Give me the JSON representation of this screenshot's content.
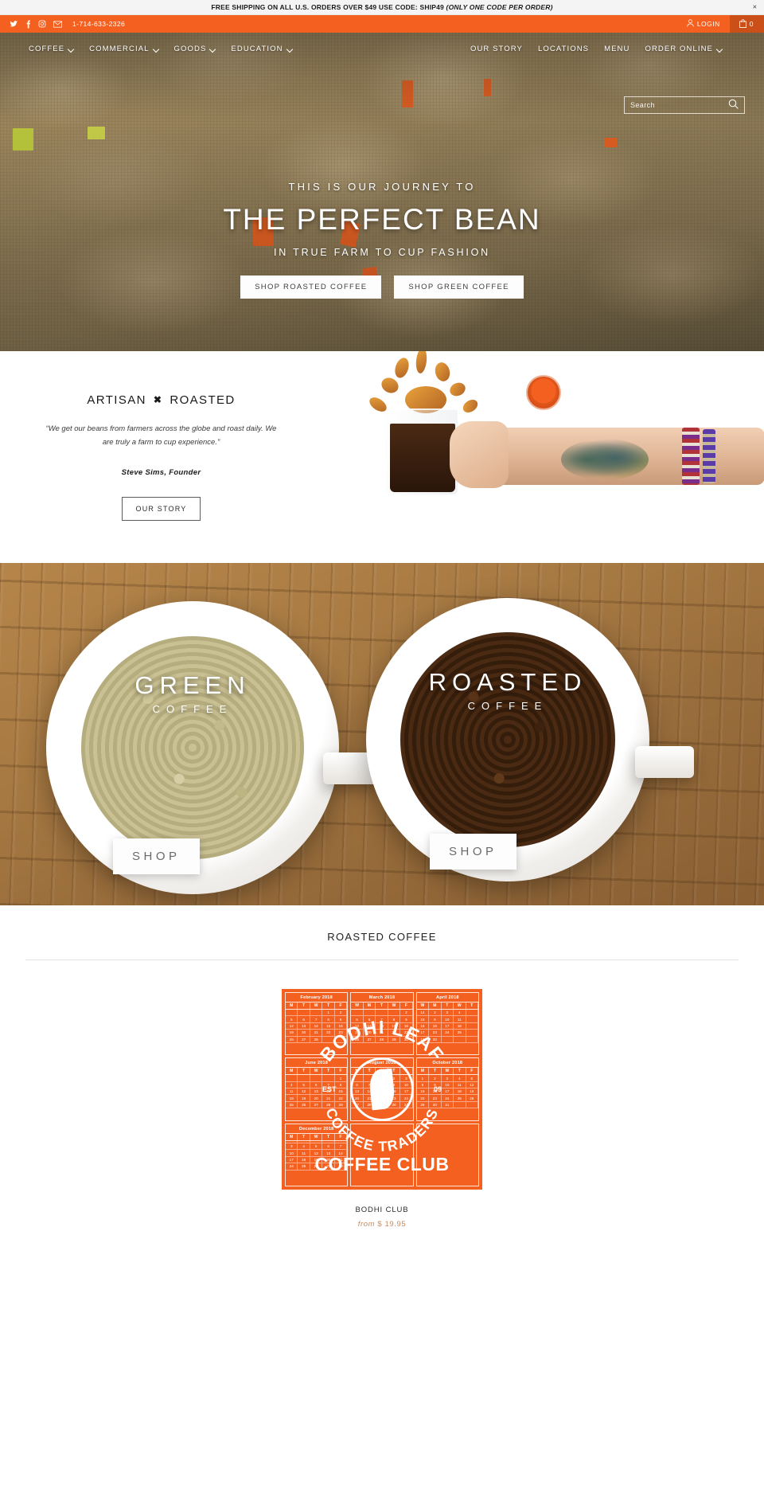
{
  "announcement": {
    "text_before": "FREE SHIPPING ON ALL U.S. ORDERS OVER $49 USE CODE: SHIP49 ",
    "text_italic": "(ONLY ONE CODE PER ORDER)",
    "close_label": "×"
  },
  "utility": {
    "phone": "1-714-633-2326",
    "login_label": "LOGIN",
    "cart_count": "0",
    "social": [
      {
        "name": "twitter-icon"
      },
      {
        "name": "facebook-icon"
      },
      {
        "name": "instagram-icon"
      },
      {
        "name": "email-icon"
      }
    ]
  },
  "nav": {
    "left": [
      {
        "label": "COFFEE",
        "caret": true
      },
      {
        "label": "COMMERCIAL",
        "caret": true
      },
      {
        "label": "GOODS",
        "caret": true
      },
      {
        "label": "EDUCATION",
        "caret": true
      }
    ],
    "right": [
      {
        "label": "OUR STORY",
        "caret": false
      },
      {
        "label": "LOCATIONS",
        "caret": false
      },
      {
        "label": "MENU",
        "caret": false
      },
      {
        "label": "ORDER ONLINE",
        "caret": true
      }
    ]
  },
  "search": {
    "placeholder": "Search",
    "value": ""
  },
  "hero": {
    "kicker": "THIS IS OUR JOURNEY TO",
    "title": "THE PERFECT BEAN",
    "subtitle": "IN TRUE FARM TO CUP FASHION",
    "button_primary": "SHOP ROASTED COFFEE",
    "button_secondary": "SHOP GREEN COFFEE"
  },
  "artisan": {
    "title_left": "ARTISAN",
    "title_mark": "✖",
    "title_right": "ROASTED",
    "quote": "“We get our beans from farmers across the globe and roast daily. We are truly a farm to cup experience.”",
    "author": "Steve Sims, Founder",
    "button": "OUR STORY"
  },
  "split": {
    "green": {
      "title": "GREEN",
      "subtitle": "COFFEE",
      "shop_label": "SHOP"
    },
    "roasted": {
      "title": "ROASTED",
      "subtitle": "COFFEE",
      "shop_label": "SHOP"
    }
  },
  "products": {
    "heading": "ROASTED COFFEE",
    "items": [
      {
        "title": "BODHI CLUB",
        "price_prefix": "from",
        "price": "$ 19.95",
        "image": {
          "brand_top": "BODHI LEAF",
          "brand_bottom": "COFFEE TRADERS",
          "est": "EST",
          "year": "09",
          "club_label": "COFFEE CLUB",
          "background_color": "#f4601f",
          "calendars": [
            {
              "month": "February 2018",
              "days": [
                "M",
                "T",
                "W",
                "T",
                "F"
              ],
              "dates": [
                "",
                "",
                "",
                "1",
                "2",
                "5",
                "6",
                "7",
                "8",
                "9",
                "12",
                "13",
                "14",
                "15",
                "16",
                "19",
                "20",
                "21",
                "22",
                "23",
                "26",
                "27",
                "28",
                "",
                ""
              ]
            },
            {
              "month": "March 2018",
              "days": [
                "W",
                "M",
                "T",
                "W",
                "T",
                "F"
              ],
              "dates": [
                "",
                "",
                "",
                "",
                "2",
                "5",
                "6",
                "7",
                "8",
                "9",
                "12",
                "13",
                "14",
                "15",
                "16",
                "19",
                "20",
                "21",
                "22",
                "23",
                "26",
                "27",
                "28",
                "29",
                "30"
              ]
            },
            {
              "month": "April 2018",
              "days": [
                "W",
                "M",
                "T",
                "W"
              ],
              "dates": [
                "14",
                "2",
                "3",
                "4",
                "15",
                "9",
                "10",
                "11",
                "16",
                "16",
                "17",
                "18",
                "17",
                "23",
                "24",
                "25",
                "18",
                "30",
                "",
                ""
              ]
            },
            {
              "month": "June 2018",
              "days": [
                "M",
                "T",
                "W",
                "T",
                "F"
              ],
              "dates": [
                "",
                "",
                "",
                "",
                "1",
                "4",
                "5",
                "6",
                "7",
                "8",
                "11",
                "12",
                "13",
                "14",
                "15",
                "18",
                "19",
                "20",
                "21",
                "22",
                "25",
                "26",
                "27",
                "28",
                "29"
              ]
            },
            {
              "month": "August 2018",
              "days": [
                "M",
                "T",
                "W",
                "T",
                "F"
              ],
              "dates": [
                "",
                "",
                "1",
                "2",
                "3",
                "6",
                "7",
                "8",
                "9",
                "10",
                "13",
                "14",
                "15",
                "16",
                "17",
                "20",
                "21",
                "22",
                "23",
                "24",
                "27",
                "28",
                "29",
                "30",
                "31"
              ]
            },
            {
              "month": "October 2018",
              "days": [
                "M",
                "T",
                "W",
                "T",
                "F"
              ],
              "dates": [
                "1",
                "2",
                "3",
                "4",
                "5",
                "8",
                "9",
                "10",
                "11",
                "12",
                "15",
                "16",
                "17",
                "18",
                "19",
                "22",
                "23",
                "24",
                "25",
                "26",
                "29",
                "30",
                "31",
                "",
                ""
              ]
            },
            {
              "month": "December 2018",
              "days": [
                "M",
                "T",
                "W",
                "T",
                "F"
              ],
              "dates": [
                "",
                "",
                "",
                "",
                "",
                "3",
                "4",
                "5",
                "6",
                "7",
                "10",
                "11",
                "12",
                "13",
                "14",
                "17",
                "18",
                "19",
                "20",
                "21",
                "24",
                "25",
                "26",
                "27",
                "28"
              ]
            }
          ]
        }
      }
    ]
  },
  "colors": {
    "brand_orange": "#f4601f",
    "announce_bg": "#f4f4f4",
    "price_color": "#c98a5e"
  }
}
